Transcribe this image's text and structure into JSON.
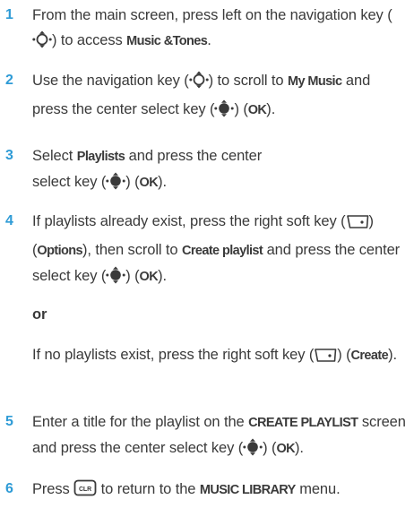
{
  "steps": [
    {
      "number": "1",
      "t1": "From the main screen, press left on the navigation key (",
      "t2": ") to access ",
      "k1": "Music &Tones",
      "t3": "."
    },
    {
      "number": "2",
      "t1": "Use the navigation key (",
      "t2": ") to scroll to ",
      "k1": "My Music",
      "t3": " and press the center select key (",
      "t4": ") (",
      "k2": "OK",
      "t5": ")."
    },
    {
      "number": "3",
      "t1": "Select ",
      "k1": "Playlists",
      "t2": " and press the center select key (",
      "t3": ") (",
      "k2": "OK",
      "t4": ")."
    },
    {
      "number": "4",
      "t1": "If playlists already exist, press the right soft key (",
      "t2": ") (",
      "k1": "Options",
      "t3": "), then scroll to ",
      "k2": "Create playlist",
      "t4": " and press the center select key (",
      "t5": ") (",
      "k3": "OK",
      "t6": ")."
    },
    {
      "or_label": "or"
    },
    {
      "t1": "If no playlists exist, press the right soft key (",
      "t2": ") (",
      "k1": "Create",
      "t3": ")."
    },
    {
      "number": "5",
      "t1": "Enter a title for the playlist on the ",
      "k1": "CREATE PLAYLIST",
      "t2": " screen and press the center select key (",
      "t3": ") (",
      "k2": "OK",
      "t4": ")."
    },
    {
      "number": "6",
      "t1": "Press ",
      "key_label": "CLR",
      "t2": " to return to the ",
      "k1": "MUSIC LIBRARY",
      "t3": " menu."
    }
  ],
  "icons": {
    "nav_key": "navigation-key-icon",
    "select_key": "center-select-key-icon",
    "soft_key": "right-soft-key-icon",
    "clear_key": "clear-key-icon"
  },
  "colors": {
    "step_number": "#2e9bd6",
    "text": "#3a3a3a"
  }
}
